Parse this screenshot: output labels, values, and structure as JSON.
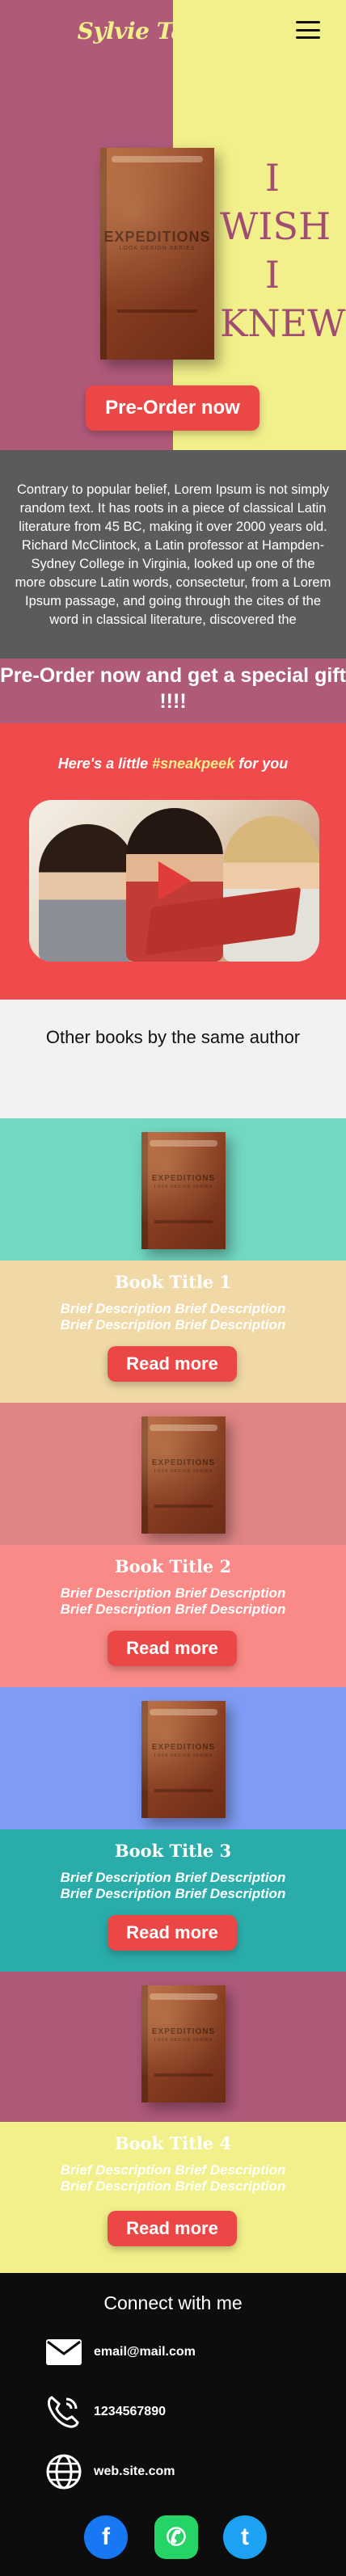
{
  "header": {
    "brand": "Sylvie Tamanda",
    "menu_icon": "hamburger-menu-icon"
  },
  "hero": {
    "cover_title": "EXPEDITIONS",
    "cover_subtitle": "LOOK DESIGN SERIES",
    "wish_lines": [
      "I",
      "WISH",
      "I",
      "KNEW"
    ],
    "cta_label": "Pre-Order now"
  },
  "about": {
    "text": "Contrary to popular belief, Lorem Ipsum is not simply random text. It has roots in a piece of classical Latin literature from 45 BC, making it over 2000 years old. Richard McClintock, a Latin professor at Hampden-Sydney College in Virginia, looked up one of the more obscure Latin words, consectetur, from a Lorem Ipsum passage, and going through the cites of the word in classical literature, discovered the"
  },
  "gift": {
    "heading": "Pre-Order now and get a special gift !!!!",
    "sneak_prefix": "Here's a little ",
    "sneak_tag": "#sneakpeek",
    "sneak_suffix": " for you",
    "video_icon": "play-icon"
  },
  "other_books": {
    "heading": "Other books by the same author",
    "books": [
      {
        "title": "Book Title 1",
        "desc1": "Brief Description Brief Description",
        "desc2": "Brief Description Brief Description",
        "button": "Read more",
        "top_color": "#72d8c4",
        "bottom_color": "#f0d9a6"
      },
      {
        "title": "Book Title 2",
        "desc1": "Brief Description Brief Description",
        "desc2": "Brief Description Brief Description",
        "button": "Read more",
        "top_color": "#e08585",
        "bottom_color": "#fa8a87"
      },
      {
        "title": "Book Title 3",
        "desc1": "Brief Description Brief Description",
        "desc2": "Brief Description Brief Description",
        "button": "Read more",
        "top_color": "#7f9cf5",
        "bottom_color": "#2aadaa"
      },
      {
        "title": "Book Title 4",
        "desc1": "Brief Description Brief Description",
        "desc2": "Brief Description Brief Description",
        "button": "Read more",
        "top_color": "#b05a7a",
        "bottom_color": "#f2f08a"
      }
    ]
  },
  "footer": {
    "heading": "Connect with me",
    "email": "email@mail.com",
    "phone": "1234567890",
    "website": "web.site.com",
    "social": [
      {
        "name": "facebook-icon",
        "glyph": "f",
        "color": "#1877f2"
      },
      {
        "name": "whatsapp-icon",
        "glyph": "✆",
        "color": "#25d366"
      },
      {
        "name": "twitter-icon",
        "glyph": "t",
        "color": "#1da1f2"
      }
    ]
  },
  "colors": {
    "accent_red": "#ec4747",
    "plum": "#b05a7a",
    "lemon": "#f2f08a"
  }
}
